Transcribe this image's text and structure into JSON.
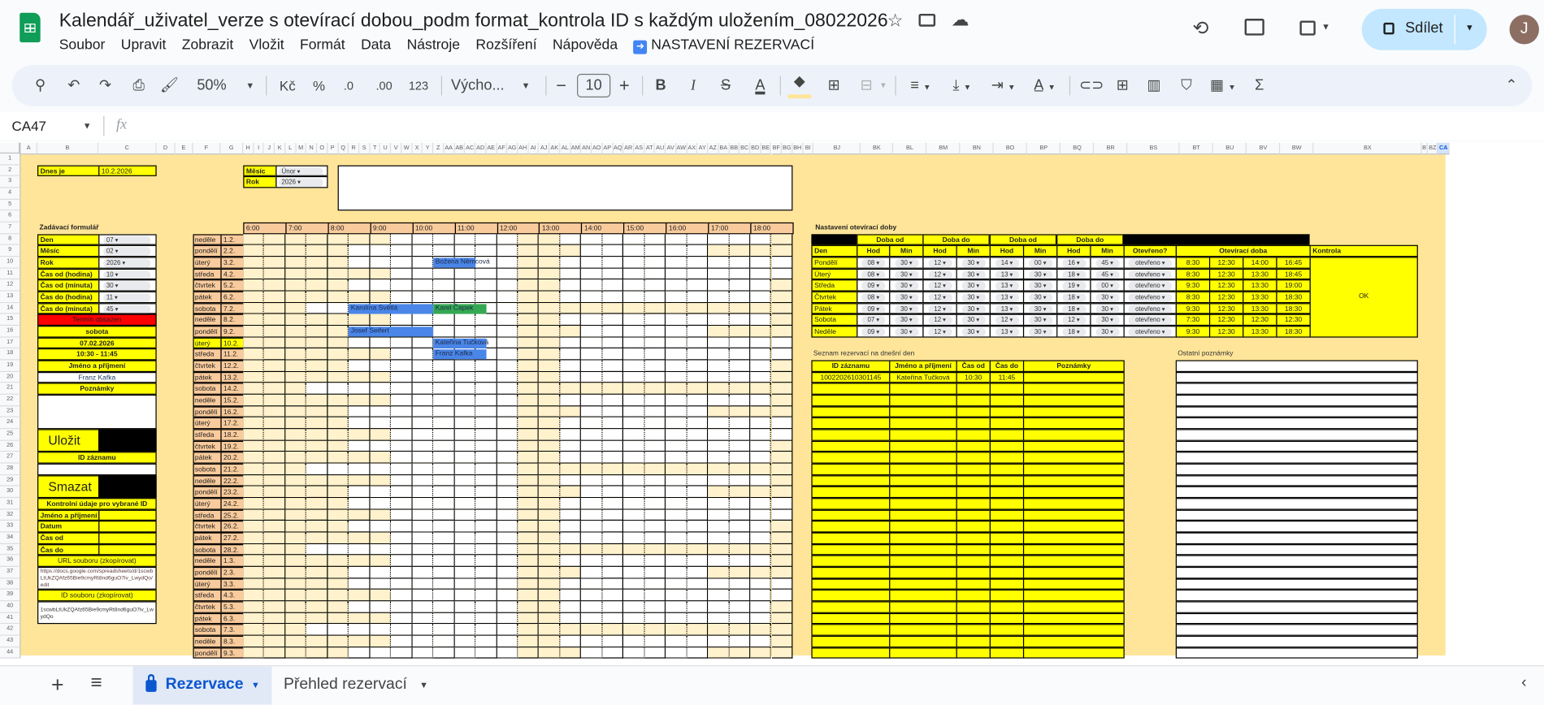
{
  "app": {
    "title": "Kalendář_uživatel_verze s otevírací dobou_podm format_kontrola ID s každým uložením_08022026",
    "menu": [
      "Soubor",
      "Upravit",
      "Zobrazit",
      "Vložit",
      "Formát",
      "Data",
      "Nástroje",
      "Rozšíření",
      "Nápověda"
    ],
    "extension_menu": "NASTAVENÍ REZERVACÍ",
    "share_label": "Sdílet",
    "avatar_initial": "J",
    "avatar_color": "#8d6e63",
    "share_color": "#c2e7ff"
  },
  "toolbar": {
    "zoom": "50%",
    "currency": "Kč",
    "percent": "%",
    "decrease_decimals": ".0",
    "increase_decimals": ".00",
    "number_format": "123",
    "font": "Výcho...",
    "font_size": "10",
    "bold": "B",
    "italic": "I",
    "strike": "S",
    "text_color": "A",
    "sum": "Σ"
  },
  "formula_bar": {
    "cell_ref": "CA47",
    "fx": "fx",
    "value": ""
  },
  "columns": [
    "A",
    "B",
    "C",
    "D",
    "E",
    "F",
    "G",
    "H",
    "I",
    "J",
    "K",
    "L",
    "M",
    "N",
    "O",
    "P",
    "Q",
    "R",
    "S",
    "T",
    "U",
    "V",
    "W",
    "X",
    "Y",
    "Z",
    "AA",
    "AB",
    "AC",
    "AD",
    "AE",
    "AF",
    "AG",
    "AH",
    "AI",
    "AJ",
    "AK",
    "AL",
    "AM",
    "AN",
    "AO",
    "AP",
    "AQ",
    "AR",
    "AS",
    "AT",
    "AU",
    "AV",
    "AW",
    "AX",
    "AY",
    "AZ",
    "BA",
    "BB",
    "BC",
    "BD",
    "BE",
    "BF",
    "BG",
    "BH",
    "BI",
    "BJ",
    "BK",
    "BL",
    "BM",
    "BN",
    "BO",
    "BP",
    "BQ",
    "BR",
    "BS",
    "BT",
    "BU",
    "BV",
    "BW",
    "BX",
    "BY",
    "BZ",
    "CA"
  ],
  "rows": [
    1,
    2,
    3,
    4,
    5,
    6,
    7,
    8,
    9,
    10,
    11,
    12,
    13,
    14,
    15,
    16,
    17,
    18,
    19,
    20,
    21,
    22,
    23,
    24,
    25,
    26,
    27,
    28,
    29,
    30,
    31,
    32,
    33,
    34,
    35,
    36,
    37,
    38,
    39,
    40,
    41,
    42,
    43,
    44
  ],
  "today": {
    "label": "Dnes je",
    "value": "10.2.2026"
  },
  "month_select": {
    "month_label": "Měsíc",
    "month_value": "Únor",
    "year_label": "Rok",
    "year_value": "2026"
  },
  "form": {
    "title": "Zadávací formulář",
    "fields": [
      {
        "label": "Den",
        "value": "07"
      },
      {
        "label": "Měsíc",
        "value": "02"
      },
      {
        "label": "Rok",
        "value": "2026"
      },
      {
        "label": "Čas od (hodina)",
        "value": "10"
      },
      {
        "label": "Čas od (minuta)",
        "value": "30"
      },
      {
        "label": "Čas do (hodina)",
        "value": "11"
      },
      {
        "label": "Čas do (minuta)",
        "value": "45"
      }
    ],
    "status": "Termín obsazen",
    "status_color": "#ff0000",
    "weekday": "sobota",
    "date": "07.02.2026",
    "time_range": "10:30 - 11:45",
    "name_label": "Jméno a příjmení",
    "name_value": "Franz Kafka",
    "notes_label": "Poznámky",
    "notes_value": "",
    "save_label": "Uložit",
    "record_id_label": "ID záznamu",
    "record_id_value": "",
    "delete_label": "Smazat",
    "check_title": "Kontrolní údaje pro vybrané ID",
    "check_fields": [
      {
        "label": "Jméno a příjmení",
        "value": ""
      },
      {
        "label": "Datum",
        "value": ""
      },
      {
        "label": "Čas od",
        "value": ""
      },
      {
        "label": "Čas do",
        "value": ""
      }
    ],
    "url_label": "URL souboru (zkopírovat)",
    "url_value": "https://docs.google.com/spreadsheets/d/1scwbLtUkZQAfz65Bie9cmyRt8nd6guO7iv_LwydQo/edit",
    "file_id_label": "ID souboru (zkopírovat)",
    "file_id_value": "1scwbLtUkZQAfz65Bie9cmyRt8nd6guO7iv_LwydQo"
  },
  "calendar": {
    "hours": [
      "6:00",
      "7:00",
      "8:00",
      "9:00",
      "10:00",
      "11:00",
      "12:00",
      "13:00",
      "14:00",
      "15:00",
      "16:00",
      "17:00",
      "18:00"
    ],
    "days": [
      {
        "day": "neděle",
        "date": "1.2."
      },
      {
        "day": "pondělí",
        "date": "2.2."
      },
      {
        "day": "úterý",
        "date": "3.2."
      },
      {
        "day": "středa",
        "date": "4.2."
      },
      {
        "day": "čtvrtek",
        "date": "5.2."
      },
      {
        "day": "pátek",
        "date": "6.2."
      },
      {
        "day": "sobota",
        "date": "7.2."
      },
      {
        "day": "neděle",
        "date": "8.2."
      },
      {
        "day": "pondělí",
        "date": "9.2."
      },
      {
        "day": "úterý",
        "date": "10.2."
      },
      {
        "day": "středa",
        "date": "11.2."
      },
      {
        "day": "čtvrtek",
        "date": "12.2."
      },
      {
        "day": "pátek",
        "date": "13.2."
      },
      {
        "day": "sobota",
        "date": "14.2."
      },
      {
        "day": "neděle",
        "date": "15.2."
      },
      {
        "day": "pondělí",
        "date": "16.2."
      },
      {
        "day": "úterý",
        "date": "17.2."
      },
      {
        "day": "středa",
        "date": "18.2."
      },
      {
        "day": "čtvrtek",
        "date": "19.2."
      },
      {
        "day": "pátek",
        "date": "20.2."
      },
      {
        "day": "sobota",
        "date": "21.2."
      },
      {
        "day": "neděle",
        "date": "22.2."
      },
      {
        "day": "pondělí",
        "date": "23.2."
      },
      {
        "day": "úterý",
        "date": "24.2."
      },
      {
        "day": "středa",
        "date": "25.2."
      },
      {
        "day": "čtvrtek",
        "date": "26.2."
      },
      {
        "day": "pátek",
        "date": "27.2."
      },
      {
        "day": "sobota",
        "date": "28.2."
      },
      {
        "day": "neděle",
        "date": "1.3."
      },
      {
        "day": "pondělí",
        "date": "2.3."
      },
      {
        "day": "úterý",
        "date": "3.3."
      },
      {
        "day": "středa",
        "date": "4.3."
      },
      {
        "day": "čtvrtek",
        "date": "5.3."
      },
      {
        "day": "pátek",
        "date": "6.3."
      },
      {
        "day": "sobota",
        "date": "7.3."
      },
      {
        "day": "neděle",
        "date": "8.3."
      },
      {
        "day": "pondělí",
        "date": "9.3."
      }
    ],
    "bookings": [
      {
        "name": "Božena Němcová",
        "date": "3.2.",
        "from": "10:30",
        "to": "11:30",
        "color": "#4a86e8"
      },
      {
        "name": "Karolína Světlá",
        "date": "7.2.",
        "from": "8:30",
        "to": "10:30",
        "color": "#4a86e8"
      },
      {
        "name": "Karel Čapek",
        "date": "7.2.",
        "from": "10:30",
        "to": "11:45",
        "color": "#34a853"
      },
      {
        "name": "Josef Seifert",
        "date": "9.2.",
        "from": "8:30",
        "to": "10:30",
        "color": "#4a86e8"
      },
      {
        "name": "Kateřina Tučková",
        "date": "10.2.",
        "from": "10:30",
        "to": "11:45",
        "color": "#4a86e8"
      },
      {
        "name": "Franz Kafka",
        "date": "11.2.",
        "from": "10:30",
        "to": "11:45",
        "color": "#4a86e8"
      }
    ],
    "colors": {
      "header": "#f9cb9c",
      "closed": "#fff2cc",
      "open": "#ffffff",
      "today": "#ffff00",
      "sheet": "#ffe599"
    }
  },
  "opening_hours": {
    "title": "Nastavení otevírací doby",
    "group_headers": [
      "Doba od",
      "Doba do",
      "Doba od",
      "Doba do"
    ],
    "headers": [
      "Den",
      "Hod",
      "Min",
      "Hod",
      "Min",
      "Hod",
      "Min",
      "Hod",
      "Min",
      "Otevřeno?"
    ],
    "hours_header": "Otevírací doba",
    "check_header": "Kontrola",
    "check_value": "OK",
    "days": [
      {
        "day": "Pondělí",
        "sel": [
          "08",
          "30",
          "12",
          "30",
          "14",
          "00",
          "16",
          "45"
        ],
        "open": "otevřeno",
        "hours": [
          "8:30",
          "12:30",
          "14:00",
          "16:45"
        ]
      },
      {
        "day": "Úterý",
        "sel": [
          "08",
          "30",
          "12",
          "30",
          "13",
          "30",
          "18",
          "45"
        ],
        "open": "otevřeno",
        "hours": [
          "8:30",
          "12:30",
          "13:30",
          "18:45"
        ]
      },
      {
        "day": "Středa",
        "sel": [
          "09",
          "30",
          "12",
          "30",
          "13",
          "30",
          "19",
          "00"
        ],
        "open": "otevřeno",
        "hours": [
          "9:30",
          "12:30",
          "13:30",
          "19:00"
        ]
      },
      {
        "day": "Čtvrtek",
        "sel": [
          "08",
          "30",
          "12",
          "30",
          "13",
          "30",
          "18",
          "30"
        ],
        "open": "otevřeno",
        "hours": [
          "8:30",
          "12:30",
          "13:30",
          "18:30"
        ]
      },
      {
        "day": "Pátek",
        "sel": [
          "09",
          "30",
          "12",
          "30",
          "13",
          "30",
          "18",
          "30"
        ],
        "open": "otevřeno",
        "hours": [
          "9:30",
          "12:30",
          "13:30",
          "18:30"
        ]
      },
      {
        "day": "Sobota",
        "sel": [
          "07",
          "30",
          "12",
          "30",
          "12",
          "30",
          "12",
          "30"
        ],
        "open": "otevřeno",
        "hours": [
          "7:30",
          "12:30",
          "12:30",
          "12:30"
        ]
      },
      {
        "day": "Neděle",
        "sel": [
          "09",
          "30",
          "12",
          "30",
          "13",
          "30",
          "18",
          "30"
        ],
        "open": "otevřeno",
        "hours": [
          "9:30",
          "12:30",
          "13:30",
          "18:30"
        ]
      }
    ]
  },
  "today_list": {
    "title": "Seznam rezervací na dnešní den",
    "headers": [
      "ID záznamu",
      "Jméno a příjmení",
      "Čas od",
      "Čas do",
      "Poznámky"
    ],
    "rows": [
      [
        "1002202610301145",
        "Kateřina Tučková",
        "10:30",
        "11:45",
        ""
      ]
    ]
  },
  "other_notes": {
    "title": "Ostatní poznámky"
  },
  "sheet_tabs": [
    {
      "label": "Rezervace",
      "active": true,
      "locked": true
    },
    {
      "label": "Přehled rezervací",
      "active": false,
      "locked": false
    }
  ]
}
